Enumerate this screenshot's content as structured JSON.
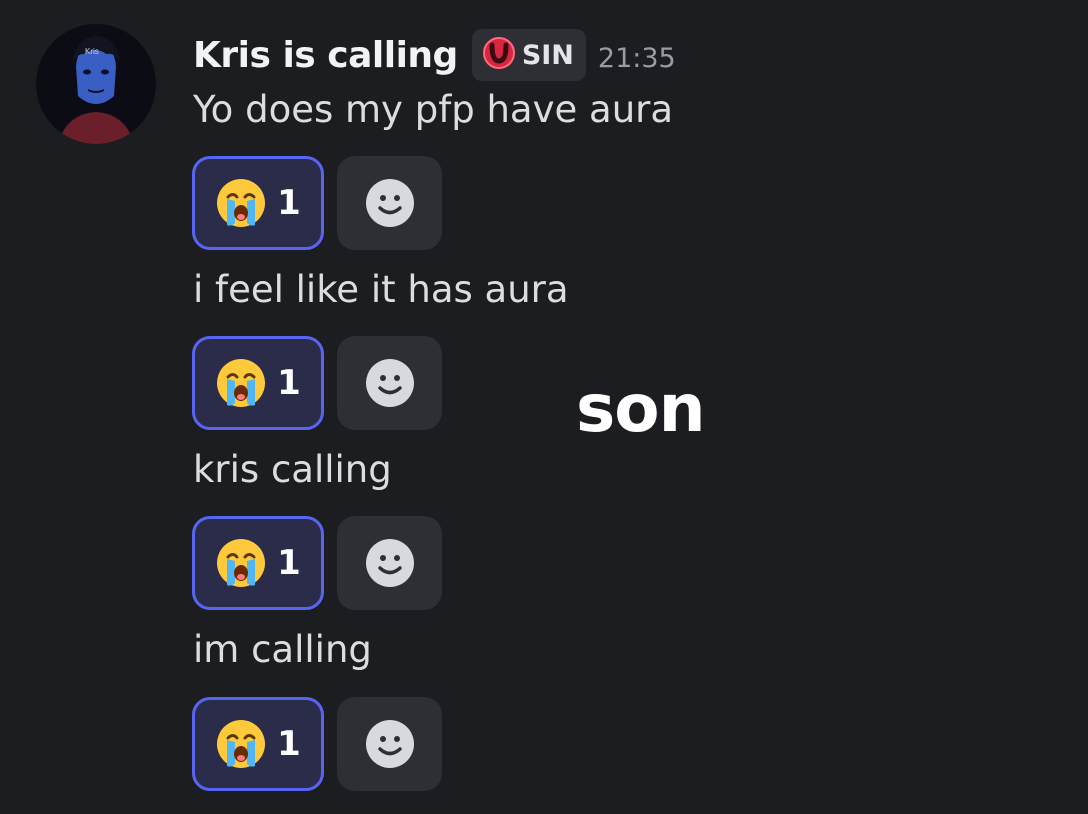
{
  "message": {
    "author": "Kris is calling",
    "tag": "SIN",
    "tag_icon": "red-horseshoe-icon",
    "time": "21:35",
    "avatar_text": "Kris"
  },
  "lines": [
    {
      "text": "Yo does my pfp have aura",
      "reaction_emoji": "loudly-crying-face",
      "reaction_count": "1"
    },
    {
      "text": "i feel like it has aura",
      "reaction_emoji": "loudly-crying-face",
      "reaction_count": "1"
    },
    {
      "text": "kris calling",
      "reaction_emoji": "loudly-crying-face",
      "reaction_count": "1"
    },
    {
      "text": "im calling",
      "reaction_emoji": "loudly-crying-face",
      "reaction_count": "1"
    }
  ],
  "overlay_text": "son",
  "colors": {
    "background": "#1c1d21",
    "reaction_border": "#5865f2",
    "reaction_bg": "#2a2c4a",
    "tag_bg": "#2e2f35"
  }
}
